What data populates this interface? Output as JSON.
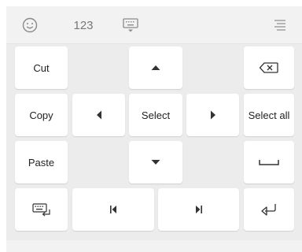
{
  "toolbar": {
    "numbers_label": "123",
    "icons": [
      "emoji-icon",
      "keyboard-hide-icon",
      "menu-icon"
    ]
  },
  "keys": {
    "cut": "Cut",
    "copy": "Copy",
    "paste": "Paste",
    "select": "Select",
    "select_all": "Select all"
  },
  "colors": {
    "keyboard_bg": "#ececec",
    "key_bg": "#ffffff",
    "toolbar_bg": "#f2f2f2",
    "icon": "#8a8a8a",
    "key_text": "#222222"
  }
}
